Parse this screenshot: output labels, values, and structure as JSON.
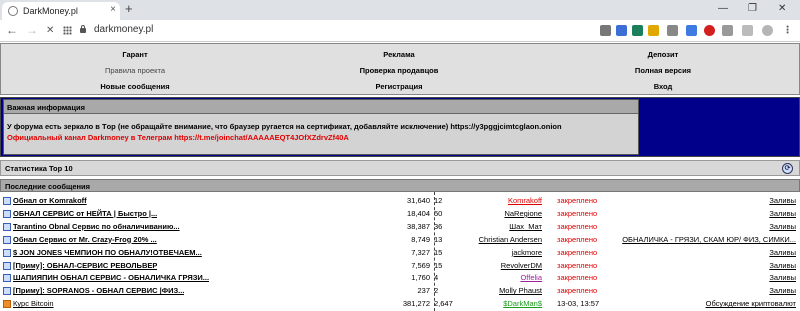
{
  "browser": {
    "tab_title": "DarkMoney.pl",
    "url": "darkmoney.pl",
    "new_tab": "+",
    "tab_close": "×",
    "back": "←",
    "forward": "→",
    "reload": "✕",
    "min": "—",
    "max": "❐",
    "close": "✕"
  },
  "forum_nav": {
    "row1": [
      "Гарант",
      "Реклама",
      "Депозит"
    ],
    "row2": [
      "Правила проекта",
      "Проверка продавцов",
      "Полная версия"
    ],
    "row3": [
      "Новые сообщения",
      "Регистрация",
      "Вход"
    ]
  },
  "important": {
    "title": "Важная информация",
    "line1": "У форума есть зеркало в Tор (не обращайте внимание, что браузер ругается на сертификат, добавляйте исключение) https://y3pggjcimtcglaon.onion",
    "line2": "Официальный канал Darkmoney в Телеграм https://t.me/joinchat/AAAAAEQT4JOfXZdrvZf40A"
  },
  "stats": {
    "title": "Статистика Top 10",
    "icon": "refresh-icon"
  },
  "latest": {
    "title": "Последние сообщения"
  },
  "topics": [
    {
      "title": "Обнал от Komrakoff",
      "views": "31,640",
      "replies": "12",
      "author": "Komrakoff",
      "author_style": "red",
      "status": "закреплено",
      "category": "Заливы",
      "icon": "doc"
    },
    {
      "title": "ОБНАЛ СЕРВИС от НЕЙТА | Быстро |...",
      "views": "18,404",
      "replies": "50",
      "author": "NaRegione",
      "author_style": "",
      "status": "закреплено",
      "category": "Заливы",
      "icon": "doc"
    },
    {
      "title": "Tarantino Obnal Сервис по обналичиванию...",
      "views": "38,387",
      "replies": "36",
      "author": "Шах_Мат",
      "author_style": "",
      "status": "закреплено",
      "category": "Заливы",
      "icon": "doc"
    },
    {
      "title": "Обнал Сервис от Mr. Crazy-Frog 20% ...",
      "views": "8,749",
      "replies": "13",
      "author": "Christian Andersen",
      "author_style": "",
      "status": "закреплено",
      "category": "ОБНАЛИЧКА - ГРЯЗИ, СКАМ ЮР/ ФИЗ, СИМКИ...",
      "icon": "doc"
    },
    {
      "title": "$ JON JONES ЧЕМПИОН ПО ОБНАЛУ!ОТВЕЧАЕМ...",
      "views": "7,327",
      "replies": "15",
      "author": "jackmore",
      "author_style": "",
      "status": "закреплено",
      "category": "Заливы",
      "icon": "doc"
    },
    {
      "title": "[Приму]: ОБНАЛ-СЕРВИС РЕВОЛЬВЕР",
      "views": "7,569",
      "replies": "15",
      "author": "RevolverDM",
      "author_style": "",
      "status": "закреплено",
      "category": "Заливы",
      "icon": "doc"
    },
    {
      "title": "ШАПИЯПИН ОБНАЛ СЕРВИС - ОБНАЛИЧКА ГРЯЗИ...",
      "views": "1,760",
      "replies": "4",
      "author": "Offelia",
      "author_style": "purple",
      "status": "закреплено",
      "category": "Заливы",
      "icon": "doc"
    },
    {
      "title": "[Приму]: SOPRANOS - ОБНАЛ СЕРВИС |ФИЗ...",
      "views": "237",
      "replies": "2",
      "author": "Molly Phaust",
      "author_style": "",
      "status": "закреплено",
      "category": "Заливы",
      "icon": "doc"
    },
    {
      "title": "Курс Bitcoin",
      "views": "381,272",
      "replies": "2,647",
      "author": "$DarkMan$",
      "author_style": "green",
      "status": "13-03, 13:57",
      "category": "Обсуждение криптовалют",
      "icon": "rss"
    }
  ]
}
